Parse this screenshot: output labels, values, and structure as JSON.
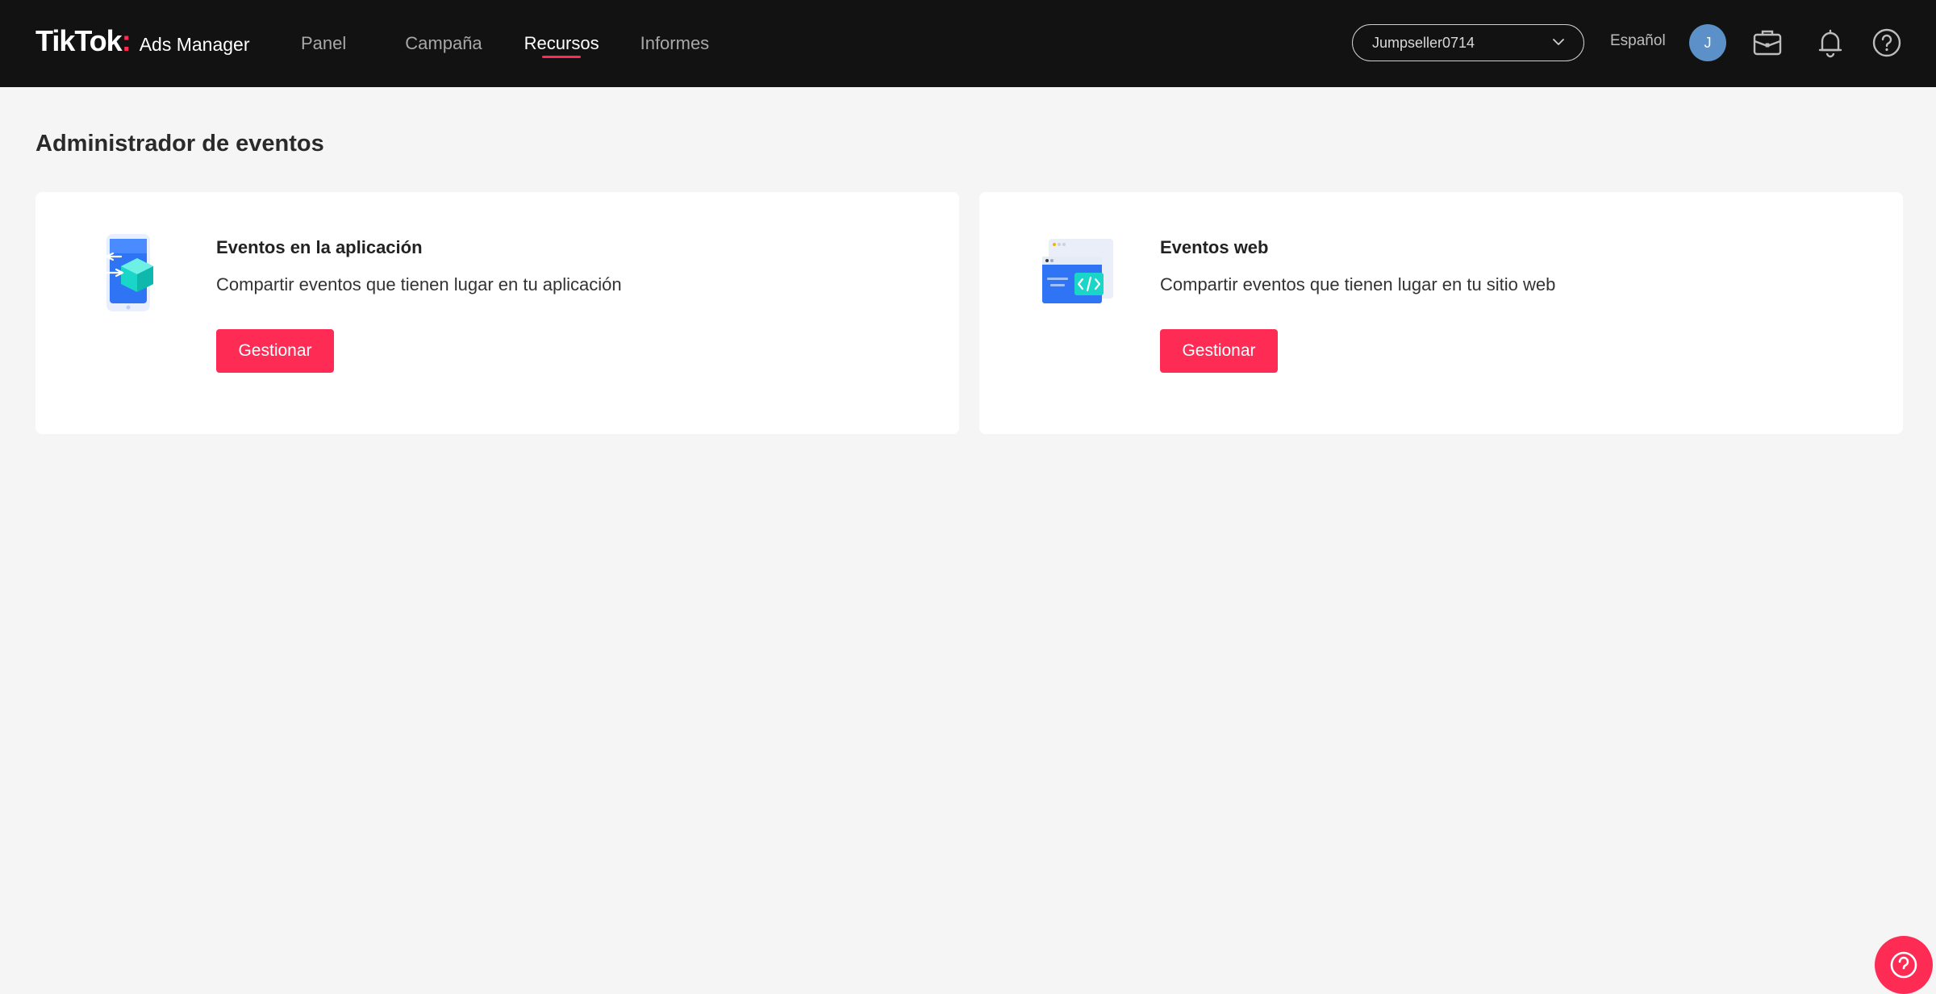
{
  "header": {
    "logo_main": "TikTok",
    "logo_dot": ":",
    "logo_sub": "Ads Manager",
    "nav": [
      {
        "label": "Panel",
        "active": false
      },
      {
        "label": "Campaña",
        "active": false
      },
      {
        "label": "Recursos",
        "active": true
      },
      {
        "label": "Informes",
        "active": false
      }
    ],
    "account": "Jumpseller0714",
    "language": "Español",
    "avatar_initial": "J",
    "icons": [
      "briefcase-icon",
      "bell-icon",
      "help-icon"
    ]
  },
  "page": {
    "title": "Administrador de eventos"
  },
  "cards": [
    {
      "title": "Eventos en la aplicación",
      "description": "Compartir eventos que tienen lugar en tu aplicación",
      "button": "Gestionar",
      "icon": "app-events-icon"
    },
    {
      "title": "Eventos web",
      "description": "Compartir eventos que tienen lugar en tu sitio web",
      "button": "Gestionar",
      "icon": "web-events-icon"
    }
  ],
  "colors": {
    "accent": "#fe2c55",
    "topbar": "#121212",
    "background": "#f5f5f5"
  }
}
